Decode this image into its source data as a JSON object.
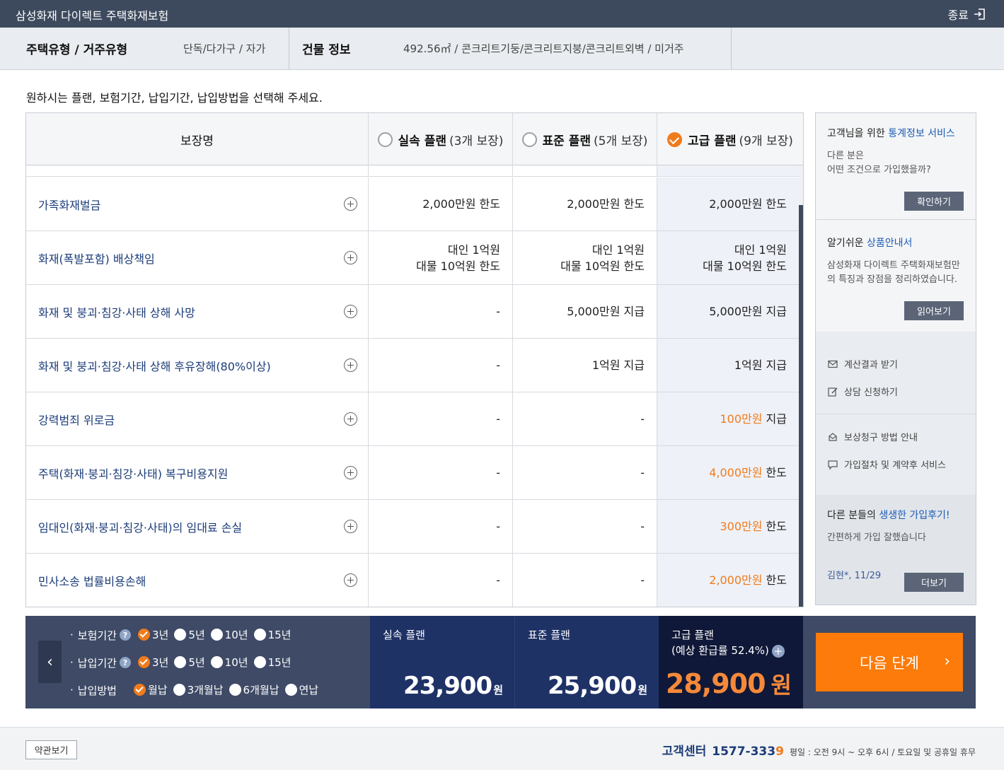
{
  "window": {
    "title": "삼성화재 다이렉트 주택화재보험",
    "exit_label": "종료"
  },
  "info": {
    "housing_label": "주택유형 / 거주유형",
    "housing_value": "단독/다가구 / 자가",
    "building_label": "건물 정보",
    "building_value": "492.56㎡ / 콘크리트기둥/콘크리트지붕/콘크리트외벽 / 미거주"
  },
  "instruction": "원하시는 플랜, 보험기간, 납입기간, 납입방법을 선택해 주세요.",
  "table": {
    "header": {
      "coverage": "보장명",
      "plans": [
        {
          "name": "실속 플랜",
          "count": "(3개 보장)",
          "selected": false
        },
        {
          "name": "표준 플랜",
          "count": "(5개 보장)",
          "selected": false
        },
        {
          "name": "고급 플랜",
          "count": "(9개 보장)",
          "selected": true
        }
      ]
    },
    "rows": [
      {
        "name": "가족화재벌금",
        "v1": [
          "2,000만원 한도"
        ],
        "v2": [
          "2,000만원 한도"
        ],
        "v3a": "",
        "v3b": "2,000만원 한도"
      },
      {
        "name": "화재(폭발포함) 배상책임",
        "v1": [
          "대인 1억원",
          "대물 10억원 한도"
        ],
        "v2": [
          "대인 1억원",
          "대물 10억원 한도"
        ],
        "v3": [
          "대인 1억원",
          "대물 10억원 한도"
        ]
      },
      {
        "name": "화재 및 붕괴·침강·사태 상해 사망",
        "v1": [
          "-"
        ],
        "v2": [
          "5,000만원 지급"
        ],
        "v3a": "",
        "v3b": "5,000만원 지급"
      },
      {
        "name": "화재 및 붕괴·침강·사태 상해 후유장해(80%이상)",
        "v1": [
          "-"
        ],
        "v2": [
          "1억원 지급"
        ],
        "v3a": "",
        "v3b": "1억원 지급"
      },
      {
        "name": "강력범죄 위로금",
        "v1": [
          "-"
        ],
        "v2": [
          "-"
        ],
        "v3a": "100만원",
        "v3b": " 지급"
      },
      {
        "name": "주택(화재·붕괴·침강·사태) 복구비용지원",
        "v1": [
          "-"
        ],
        "v2": [
          "-"
        ],
        "v3a": "4,000만원",
        "v3b": " 한도"
      },
      {
        "name": "임대인(화재·붕괴·침강·사태)의 임대료 손실",
        "v1": [
          "-"
        ],
        "v2": [
          "-"
        ],
        "v3a": "300만원",
        "v3b": " 한도"
      },
      {
        "name": "민사소송 법률비용손해",
        "v1": [
          "-"
        ],
        "v2": [
          "-"
        ],
        "v3a": "2,000만원",
        "v3b": " 한도"
      }
    ]
  },
  "sidebar": {
    "stats_title_pre": "고객님을 위한 ",
    "stats_title_hl": "통계정보 서비스",
    "stats_desc_1": "다른 분은",
    "stats_desc_2": "어떤 조건으로 가입했을까?",
    "stats_button": "확인하기",
    "guide_title_pre": "알기쉬운 ",
    "guide_title_hl": "상품안내서",
    "guide_desc": "삼성화재 다이렉트 주택화재보험만의 특징과 장점을 정리하였습니다.",
    "guide_button": "읽어보기",
    "links": [
      "계산결과 받기",
      "상담 신청하기",
      "보상청구 방법 안내",
      "가입절차 및 계약후 서비스"
    ],
    "review_title_pre": "다른 분들의 ",
    "review_title_hl": "생생한 가입후기!",
    "review_text": "간편하게 가입 잘했습니다",
    "review_author": "김현*, 11/29",
    "review_button": "더보기"
  },
  "options": {
    "period_label": "보험기간",
    "period_choices": [
      "3년",
      "5년",
      "10년",
      "15년"
    ],
    "period_selected": 0,
    "pay_period_label": "납입기간",
    "pay_period_choices": [
      "3년",
      "5년",
      "10년",
      "15년"
    ],
    "pay_period_selected": 0,
    "pay_method_label": "납입방법",
    "pay_method_choices": [
      "월납",
      "3개월납",
      "6개월납",
      "연납"
    ],
    "pay_method_selected": 0
  },
  "prices": {
    "basic_name": "실속 플랜",
    "basic_amount": "23,900",
    "standard_name": "표준 플랜",
    "standard_amount": "25,900",
    "premium_name": "고급 플랜",
    "premium_refund": "(예상 환급률 52.4%)",
    "premium_amount": "28,900",
    "won": "원"
  },
  "next_button": "다음 단계",
  "footer": {
    "terms_button": "약관보기",
    "cs_label": "고객센터",
    "cs_number_main": "1577-333",
    "cs_number_last": "9",
    "hours": "평일 : 오전 9시 ~ 오후 6시 / 토요일 및 공휴일 휴무"
  },
  "colors": {
    "accent": "#f07b1c",
    "navy": "#1c3c78",
    "topbar": "#3d4a5e",
    "bottom_panel": "#3e4a66"
  }
}
